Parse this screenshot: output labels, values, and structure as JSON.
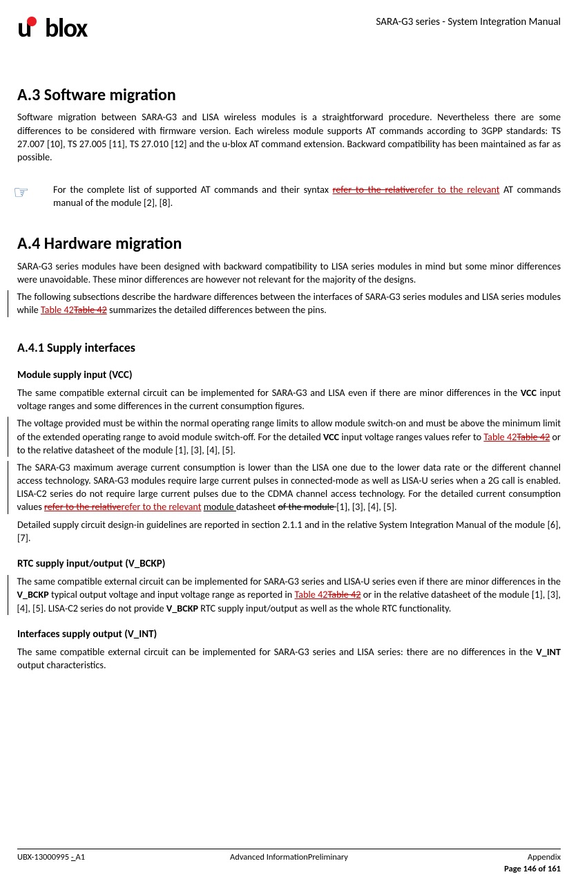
{
  "header": {
    "logo_text": "blox",
    "doc_title": "SARA-G3 series - System Integration Manual"
  },
  "sections": {
    "a3": {
      "heading": "A.3  Software migration",
      "p1": "Software migration between SARA-G3 and LISA wireless modules is a straightforward procedure. Nevertheless there are some differences to be considered with firmware version. Each wireless module supports AT commands according to 3GPP standards: TS 27.007 [10], TS 27.005 [11], TS 27.010 [12] and the u-blox AT command extension. Backward compatibility has been maintained as far as possible.",
      "note_pre": "For the complete list of supported AT commands and their syntax ",
      "note_del": "refer to the relative",
      "note_ins": "refer to the relevant",
      "note_post": " AT commands manual of the module [2], [8]."
    },
    "a4": {
      "heading": "A.4  Hardware migration",
      "p1": "SARA-G3 series modules have been designed with backward compatibility to LISA series modules in mind but some minor differences were unavoidable. These minor differences are however not relevant for the majority of the designs.",
      "p2_pre": "The following subsections describe the hardware differences between the interfaces of SARA-G3 series modules and LISA series modules while ",
      "p2_link_new": "Table 42",
      "p2_link_del": "Table 42",
      "p2_post": " summarizes the detailed differences between the pins."
    },
    "a41": {
      "heading": "A.4.1  Supply interfaces",
      "vcc": {
        "heading": "Module supply input (VCC)",
        "p1a": "The same compatible external circuit can be implemented for SARA-G3 and LISA even if there are minor differences in the ",
        "p1_b": "VCC",
        "p1c": " input voltage ranges and some differences in the current consumption figures.",
        "p2a": "The voltage provided must be within the normal operating range limits to allow module switch-on and must be above the minimum limit of the extended operating range to avoid module switch-off. For the detailed ",
        "p2_b": "VCC",
        "p2c": " input voltage ranges values refer to ",
        "p2_link_new": "Table 42",
        "p2_link_del": "Table 42",
        "p2d": " or to the relative datasheet of the module [1], [3], [4], [5].",
        "p3a": "The SARA-G3 maximum average current consumption is lower than the LISA one due to the lower data rate or the different channel access technology. SARA-G3 modules require large current pulses in connected-mode as well as LISA-U series when a 2G call is enabled. LISA-C2 series do not require large current pulses due to the CDMA channel access technology. For the detailed current consumption values ",
        "p3_del1": "refer to the relative",
        "p3_ins1": "refer to the relevant",
        "p3_sp": " ",
        "p3_ins2": "module ",
        "p3b": "datasheet ",
        "p3_del2": "of the module ",
        "p3c": "[1], [3], [4], [5].",
        "p4": "Detailed supply circuit design-in guidelines are reported in section 2.1.1 and in the relative System Integration Manual of the module [6], [7]."
      },
      "vbckp": {
        "heading": "RTC supply input/output (V_BCKP)",
        "p1a": "The same compatible external circuit can be implemented for SARA-G3 series and LISA-U series even if there are minor differences in the ",
        "p1_b": "V_BCKP",
        "p1c": " typical output voltage and input voltage range as reported in ",
        "p1_link_new": "Table 42",
        "p1_link_del": "Table 42",
        "p1d": " or in the relative datasheet of the module [1], [3], [4], [5]. LISA-C2 series do not provide ",
        "p1_b2": "V_BCKP",
        "p1e": " RTC supply input/output as well as the whole RTC functionality."
      },
      "vint": {
        "heading": "Interfaces supply output (V_INT)",
        "p1a": "The same compatible external circuit can be implemented for SARA-G3 series and LISA series: there are no differences in the ",
        "p1_b": "V_INT",
        "p1c": " output characteristics."
      }
    }
  },
  "footer": {
    "left_id": "UBX-13000995 ",
    "left_ins": "- ",
    "left_rev": "A1",
    "center": "Advanced InformationPreliminary",
    "right_top": "Appendix",
    "right_bottom": "Page 146 of 161"
  }
}
